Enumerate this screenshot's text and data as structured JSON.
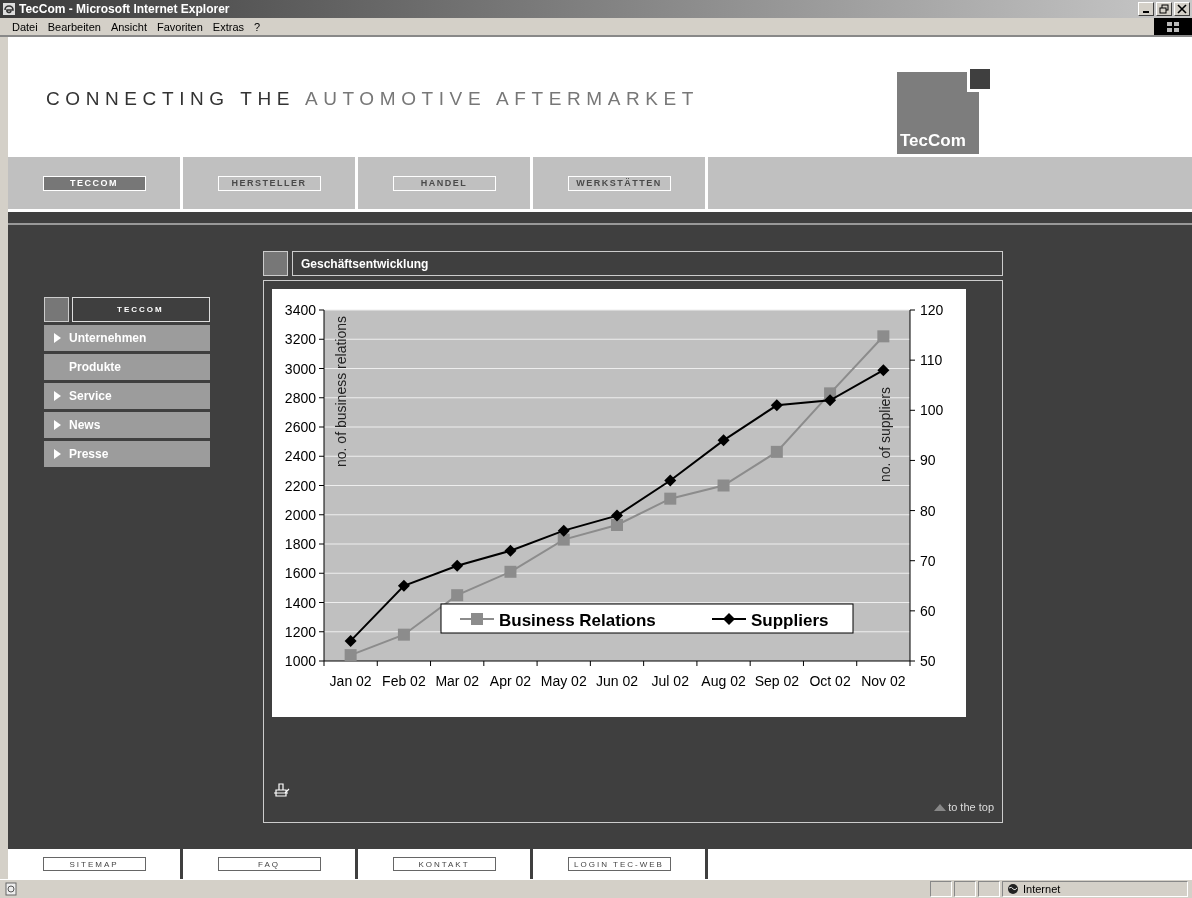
{
  "window": {
    "title": "TecCom - Microsoft Internet Explorer"
  },
  "menu": [
    "Datei",
    "Bearbeiten",
    "Ansicht",
    "Favoriten",
    "Extras",
    "?"
  ],
  "header": {
    "tagline": "**CONNECTING THE** AUTOMOTIVE AFTERMARKET",
    "logo": "TecCom"
  },
  "nav": [
    {
      "label": "TECCOM",
      "selected": true
    },
    {
      "label": "HERSTELLER",
      "selected": false
    },
    {
      "label": "HANDEL",
      "selected": false
    },
    {
      "label": "WERKSTÄTTEN",
      "selected": false
    }
  ],
  "sidebar": {
    "title": "TECCOM",
    "items": [
      {
        "label": "Unternehmen",
        "arrow": true
      },
      {
        "label": "Produkte",
        "arrow": false
      },
      {
        "label": "Service",
        "arrow": true
      },
      {
        "label": "News",
        "arrow": true
      },
      {
        "label": "Presse",
        "arrow": true
      }
    ]
  },
  "panel": {
    "title": "Geschäftsentwicklung",
    "to_top": "to the top",
    "chart_data": {
      "type": "line",
      "ylabel": "no. of business relations",
      "y2label": "no. of suppliers",
      "categories": [
        "Jan 02",
        "Feb 02",
        "Mar 02",
        "Apr 02",
        "May 02",
        "Jun 02",
        "Jul 02",
        "Aug 02",
        "Sep 02",
        "Oct 02",
        "Nov 02"
      ],
      "ylim": [
        1000,
        3400
      ],
      "yticks": [
        1000,
        1200,
        1400,
        1600,
        1800,
        2000,
        2200,
        2400,
        2600,
        2800,
        3000,
        3200,
        3400
      ],
      "y2lim": [
        50,
        120
      ],
      "grid": true,
      "legend": "bottom",
      "y2ticks": [
        50,
        60,
        70,
        80,
        90,
        100,
        110,
        120
      ],
      "series": [
        {
          "name": "Business Relations",
          "color": "#8c8c8c",
          "marker": "square",
          "values": [
            1040,
            1180,
            1450,
            1610,
            1830,
            1930,
            2110,
            2200,
            2430,
            2830,
            3220
          ]
        },
        {
          "name": "Suppliers",
          "color": "#000000",
          "axis": "y2",
          "marker": "diamond",
          "values": [
            54,
            65,
            69,
            72,
            76,
            79,
            86,
            94,
            101,
            102,
            108
          ]
        }
      ]
    }
  },
  "footer": [
    "SITEMAP",
    "FAQ",
    "KONTAKT",
    "LOGIN TEC-WEB"
  ],
  "status_bar": {
    "zone": "Internet"
  }
}
